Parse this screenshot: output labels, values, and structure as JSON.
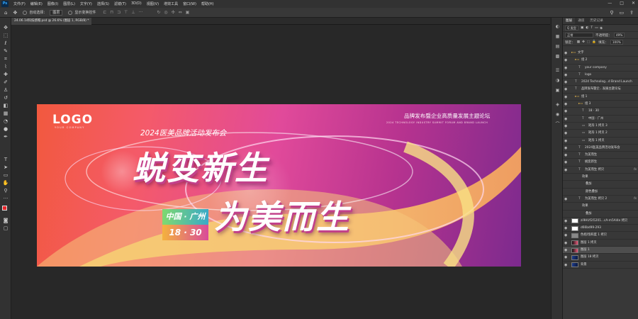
{
  "app": {
    "logo": "Ps"
  },
  "menu": [
    "文件(F)",
    "编辑(E)",
    "图像(I)",
    "图层(L)",
    "文字(Y)",
    "选择(S)",
    "滤镜(T)",
    "3D(D)",
    "视图(V)",
    "增效工具",
    "窗口(W)",
    "帮助(H)"
  ],
  "window_controls": {
    "minimize": "—",
    "maximize": "□",
    "close": "✕"
  },
  "options": {
    "auto_select_label": "自动选择：",
    "auto_select_value": "图层",
    "show_transform_label": "显示变换控件"
  },
  "document_tab": "24.06.14科技感帽.psd @ 26.6% (图层 1, RGB/8) *",
  "canvas": {
    "logo": "LOGO",
    "logo_sub": "YOUR COMPANY",
    "right_title": "品牌发布暨企业高质量发展主题论坛",
    "right_sub": "2024 TECHNOLOGY INDUSTRY SUMMIT FORUM AND BRAND LAUNCH",
    "event_sub": "2024医美品牌活动发布会",
    "headline1": "蜕变新生",
    "headline2": "为美而生",
    "city": "中国 · 广州",
    "date": "18 · 30"
  },
  "layers_panel": {
    "tabs": [
      "图层",
      "通道",
      "历史记录"
    ],
    "filter_label": "Q 类型",
    "blend_mode": "正常",
    "opacity_label": "不透明度：",
    "opacity_value": "49%",
    "lock_label": "锁定：",
    "fill_label": "填充：",
    "fill_value": "100%"
  },
  "layers": [
    {
      "name": "文字",
      "indent": 0,
      "type": "group"
    },
    {
      "name": "组 2",
      "indent": 1,
      "type": "group"
    },
    {
      "name": "your company",
      "indent": 2,
      "type": "text"
    },
    {
      "name": "logo",
      "indent": 2,
      "type": "text"
    },
    {
      "name": "2024 Technolog...d Brand Launch",
      "indent": 1,
      "type": "text"
    },
    {
      "name": "品牌发布暨企...发展主题论坛",
      "indent": 1,
      "type": "text"
    },
    {
      "name": "组 1",
      "indent": 1,
      "type": "group"
    },
    {
      "name": "组 3",
      "indent": 2,
      "type": "group"
    },
    {
      "name": "18 · 30",
      "indent": 3,
      "type": "text"
    },
    {
      "name": "中国 · 广州",
      "indent": 3,
      "type": "text"
    },
    {
      "name": "矩形 1 拷贝 3",
      "indent": 3,
      "type": "shape"
    },
    {
      "name": "矩形 1 拷贝 2",
      "indent": 3,
      "type": "shape"
    },
    {
      "name": "矩形 1 拷贝",
      "indent": 3,
      "type": "shape"
    },
    {
      "name": "2024医美品牌活动发布会",
      "indent": 2,
      "type": "text"
    },
    {
      "name": "为美而生",
      "indent": 2,
      "type": "text"
    },
    {
      "name": "蜕变新生",
      "indent": 2,
      "type": "text"
    },
    {
      "name": "为美而生 拷贝",
      "indent": 2,
      "type": "text",
      "fx": "fx"
    },
    {
      "name": "效果",
      "indent": 3,
      "type": "effect"
    },
    {
      "name": "叠加",
      "indent": 4,
      "type": "effect"
    },
    {
      "name": "颜色叠加",
      "indent": 4,
      "type": "effect"
    },
    {
      "name": "为美而生 拷贝 2",
      "indent": 2,
      "type": "text",
      "fx": "fx"
    },
    {
      "name": "效果",
      "indent": 3,
      "type": "effect"
    },
    {
      "name": "叠加",
      "indent": 4,
      "type": "effect"
    },
    {
      "name": "zi9HUf2i5201...cA-m5Al4e 拷贝",
      "indent": 0,
      "type": "image"
    },
    {
      "name": "d66bd99-293",
      "indent": 0,
      "type": "image"
    },
    {
      "name": "色相/饱和度 1 拷贝",
      "indent": 0,
      "type": "adjust"
    },
    {
      "name": "图层 1 拷贝",
      "indent": 0,
      "type": "image"
    },
    {
      "name": "图层 1",
      "indent": 0,
      "type": "image",
      "selected": true
    },
    {
      "name": "图层 18 拷贝",
      "indent": 0,
      "type": "image"
    },
    {
      "name": "背景",
      "indent": 0,
      "type": "image"
    }
  ],
  "colors": {
    "foreground": "#e8262b",
    "background": "#ffffff",
    "accent": "#31a8ff"
  }
}
